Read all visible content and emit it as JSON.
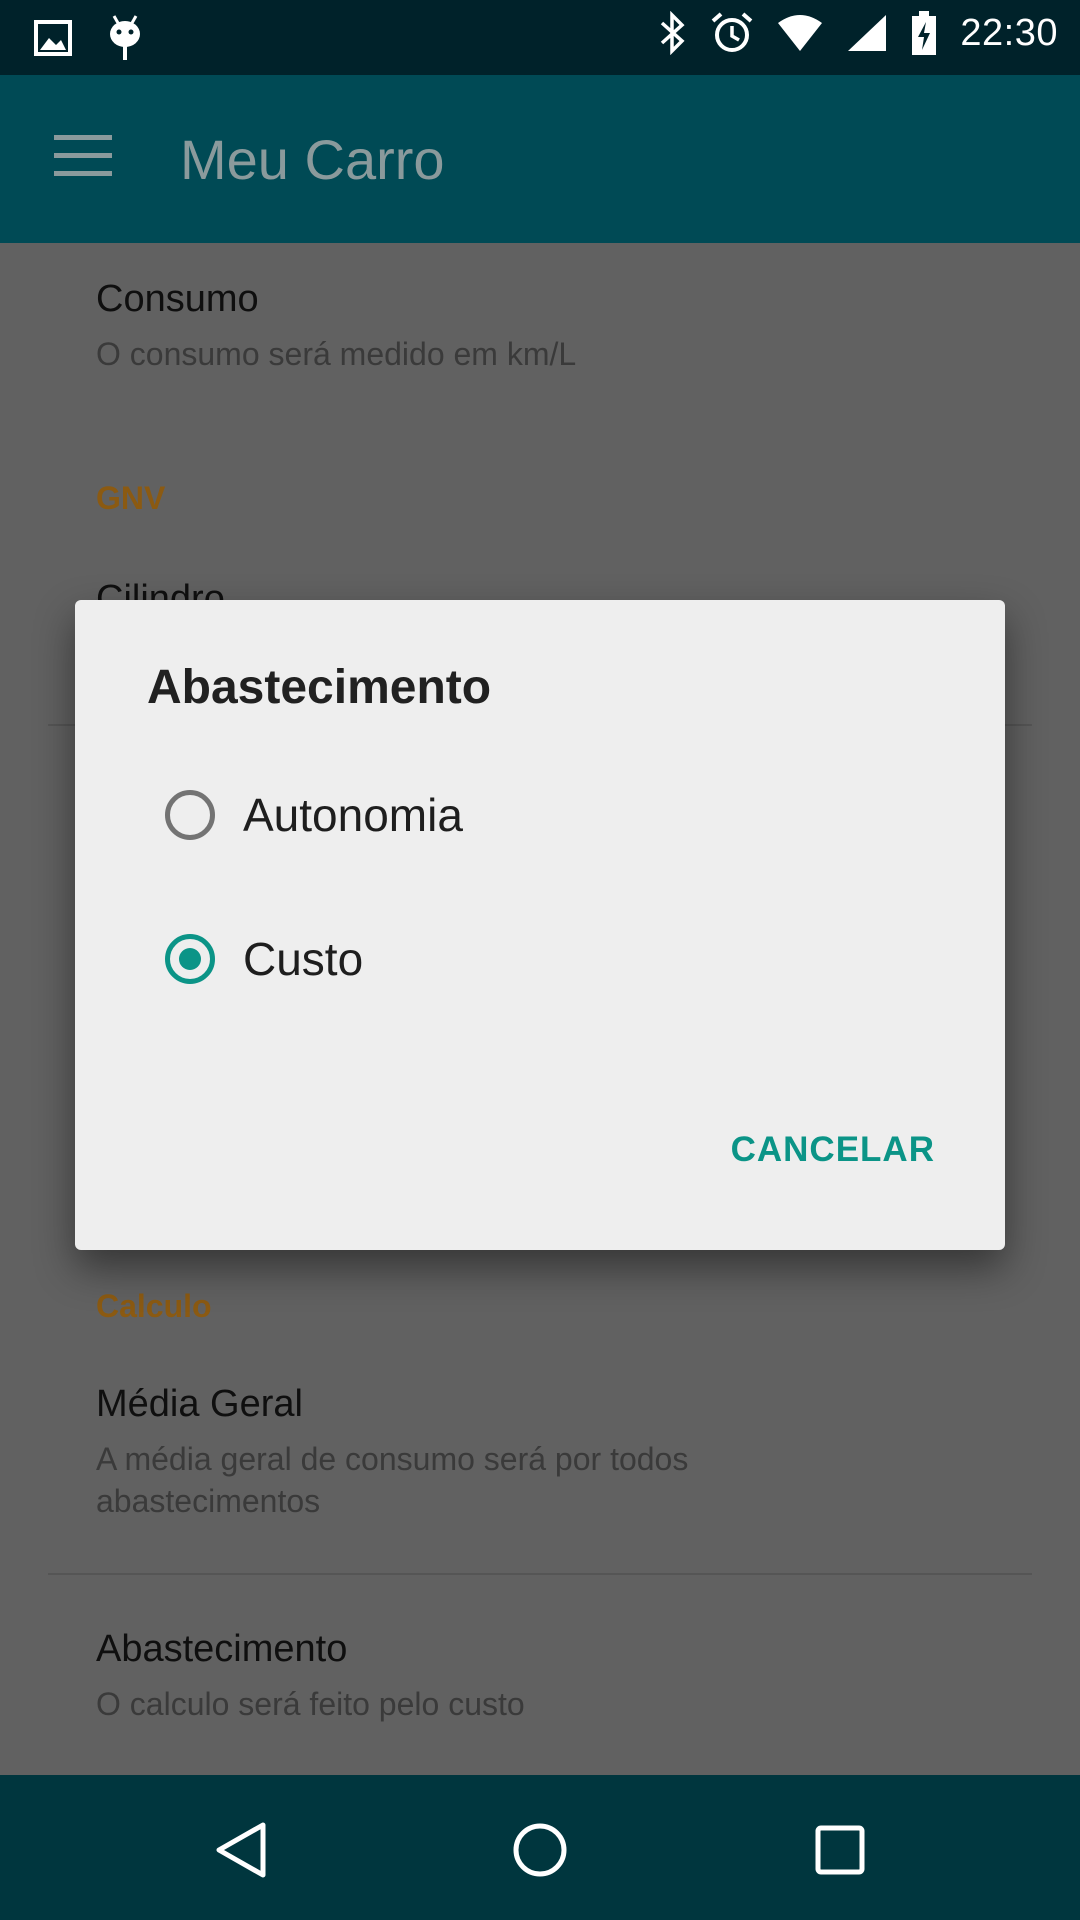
{
  "status_bar": {
    "time": "22:30",
    "left_icons": [
      "gallery-icon",
      "android-debug-icon"
    ],
    "right_icons": [
      "bluetooth-icon",
      "alarm-icon",
      "wifi-icon",
      "signal-icon",
      "battery-charging-icon"
    ]
  },
  "app_bar": {
    "title": "Meu Carro",
    "menu_icon": "hamburger-menu-icon"
  },
  "settings": {
    "consumo": {
      "title": "Consumo",
      "summary": "O consumo será medido em km/L"
    },
    "gnv_header": "GNV",
    "cilindro": {
      "title": "Cilindro"
    },
    "calculo_header": "Calculo",
    "media_geral": {
      "title": "Média Geral",
      "summary": "A média geral de consumo será por todos abastecimentos"
    },
    "abastecimento": {
      "title": "Abastecimento",
      "summary": "O calculo será feito pelo custo"
    }
  },
  "dialog": {
    "title": "Abastecimento",
    "options": [
      {
        "label": "Autonomia",
        "checked": false
      },
      {
        "label": "Custo",
        "checked": true
      }
    ],
    "cancel_label": "CANCELAR"
  },
  "colors": {
    "accent": "#0b9487",
    "app_bar": "#004a55",
    "status_bar": "#00222a",
    "nav_bar": "#00363e",
    "section_header": "#8b5a12"
  },
  "nav_bar": {
    "icons": [
      "back-icon",
      "home-icon",
      "recents-icon"
    ]
  }
}
